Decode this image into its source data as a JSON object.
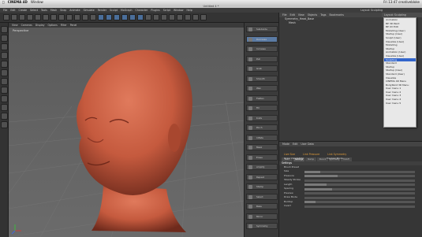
{
  "mac_menu": {
    "app": "CINEMA 4D",
    "window": "Window",
    "right": "Fri 13:47 creativebloke"
  },
  "window_title": "Untitled 4 *",
  "menubar": [
    "File",
    "Edit",
    "Create",
    "Select",
    "Tools",
    "Mesh",
    "Snap",
    "Animate",
    "Simulate",
    "Render",
    "Sculpt",
    "MoGraph",
    "Character",
    "Plugins",
    "Script",
    "Window",
    "Help"
  ],
  "menubar_right": "Layout: Sculpting",
  "viewport_menu": [
    "View",
    "Cameras",
    "Display",
    "Options",
    "Filter",
    "Panel"
  ],
  "viewport_label": "Perspective",
  "sculpt_tools": [
    "Subdivide",
    "Decrease",
    "Increase",
    "Pull",
    "Grab",
    "Smooth",
    "Wax",
    "Flatten",
    "Fill",
    "Knife",
    "Pinch",
    "Inflate",
    "Mask",
    "Erase",
    "Amplify",
    "Repeat",
    "Stamp",
    "Select",
    "Bake",
    "Mirror",
    "Symmetry"
  ],
  "sculpt_tool_selected": 1,
  "obj_manager": {
    "menu": [
      "File",
      "Edit",
      "View",
      "Objects",
      "Tags",
      "Bookmarks"
    ],
    "rows": [
      "Symmetry_Head_Base",
      "Mesh"
    ]
  },
  "layout_dropdown": {
    "items": [
      "Animation",
      "BP 3D Paint",
      "BP UV Edit",
      "Modelling (User)",
      "Startup (User)",
      "Sculpt (User)",
      "Visualize (User)",
      "Modelling",
      "Startup",
      "Animation (User)",
      "Visualize (User)",
      "Sculpting",
      "Standard",
      "Startup",
      "Startup (User)",
      "Standard (User)",
      "Visualize",
      "CINEMA 4D Menu",
      "BodyPaint 3D Menu",
      "User menu 1",
      "User menu 2",
      "User menu 3",
      "User menu 4",
      "User menu 5"
    ],
    "selected": 11
  },
  "attr_manager": {
    "menu": [
      "Mode",
      "Edit",
      "User Data"
    ],
    "tabs": [
      "Basic",
      "Settings",
      "Stamp",
      "Stencil",
      "Symmetry",
      "Falloff"
    ],
    "tab_active": 1,
    "title_line": [
      "Live Size",
      "Link Pressure",
      "Link Symmetry"
    ],
    "row_visual": "Draw Visual Size",
    "row_preview": "Preview Mode",
    "section": "Settings",
    "brush": "Brush Preset",
    "controls": [
      {
        "label": "Size",
        "value": 0.14
      },
      {
        "label": "Pressure",
        "value": 0.3
      },
      {
        "label": "Steady Stroke",
        "value": 0
      },
      {
        "label": "Length",
        "value": 0.2
      },
      {
        "label": "Spacing",
        "value": 0.25
      },
      {
        "label": "Preview",
        "value": 0.0
      },
      {
        "label": "Draw Mode",
        "value": 0.0
      },
      {
        "label": "Buildup",
        "value": 0.1
      },
      {
        "label": "Invert",
        "value": 0.0
      }
    ]
  },
  "colors": {
    "skin": "#c55a3e",
    "accent": "#e09b3a",
    "select": "#3366cc"
  }
}
